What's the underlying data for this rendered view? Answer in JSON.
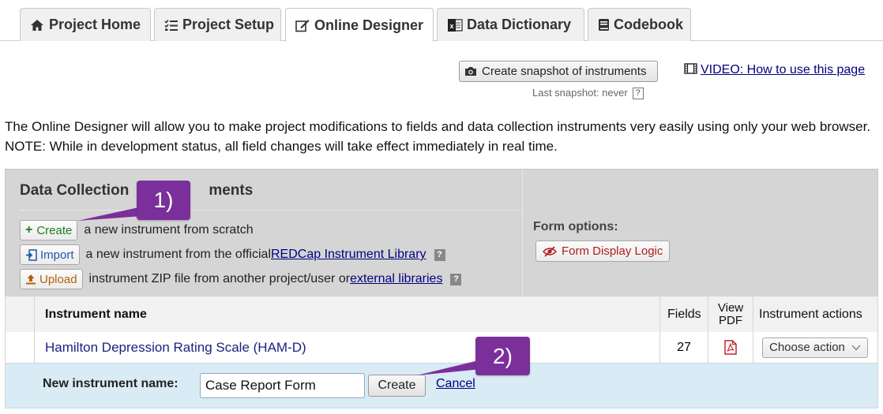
{
  "tabs": [
    {
      "label": "Project Home",
      "icon": "home-icon"
    },
    {
      "label": "Project Setup",
      "icon": "checklist-icon"
    },
    {
      "label": "Online Designer",
      "icon": "edit-icon"
    },
    {
      "label": "Data Dictionary",
      "icon": "spreadsheet-icon"
    },
    {
      "label": "Codebook",
      "icon": "book-icon"
    }
  ],
  "active_tab": "Online Designer",
  "snapshot": {
    "button_label": "Create snapshot of instruments",
    "last_snapshot_text": "Last snapshot: never",
    "help": "?"
  },
  "video_link": "VIDEO: How to use this page",
  "intro_text": "The Online Designer will allow you to make project modifications to fields and data collection instruments very easily using only your web browser. NOTE: While in development status, all field changes will take effect immediately in real time.",
  "panel": {
    "title_left": "Data Collection",
    "title_right": "ments",
    "create": {
      "button": "Create",
      "text": "a new instrument from scratch"
    },
    "import": {
      "button": "Import",
      "text": "a new instrument from the official ",
      "link": "REDCap Instrument Library",
      "help": "?"
    },
    "upload": {
      "button": "Upload",
      "text": "instrument ZIP file from another project/user or ",
      "link": "external libraries",
      "help": "?"
    },
    "form_options_title": "Form options:",
    "form_display_logic": "Form Display Logic"
  },
  "table": {
    "headers": {
      "name": "Instrument name",
      "fields": "Fields",
      "view_pdf_1": "View",
      "view_pdf_2": "PDF",
      "actions": "Instrument actions"
    },
    "rows": [
      {
        "name": "Hamilton Depression Rating Scale (HAM-D)",
        "fields": "27",
        "action": "Choose action"
      }
    ]
  },
  "new_instrument": {
    "label": "New instrument name:",
    "value": "Case Report Form",
    "create_label": "Create",
    "cancel_label": "Cancel"
  },
  "callouts": {
    "one": "1)",
    "two": "2)"
  },
  "colors": {
    "callout": "#7b2f9a",
    "link": "#000080",
    "panel_bg": "#d5d5d5",
    "new_row_bg": "#d9ebf5"
  }
}
